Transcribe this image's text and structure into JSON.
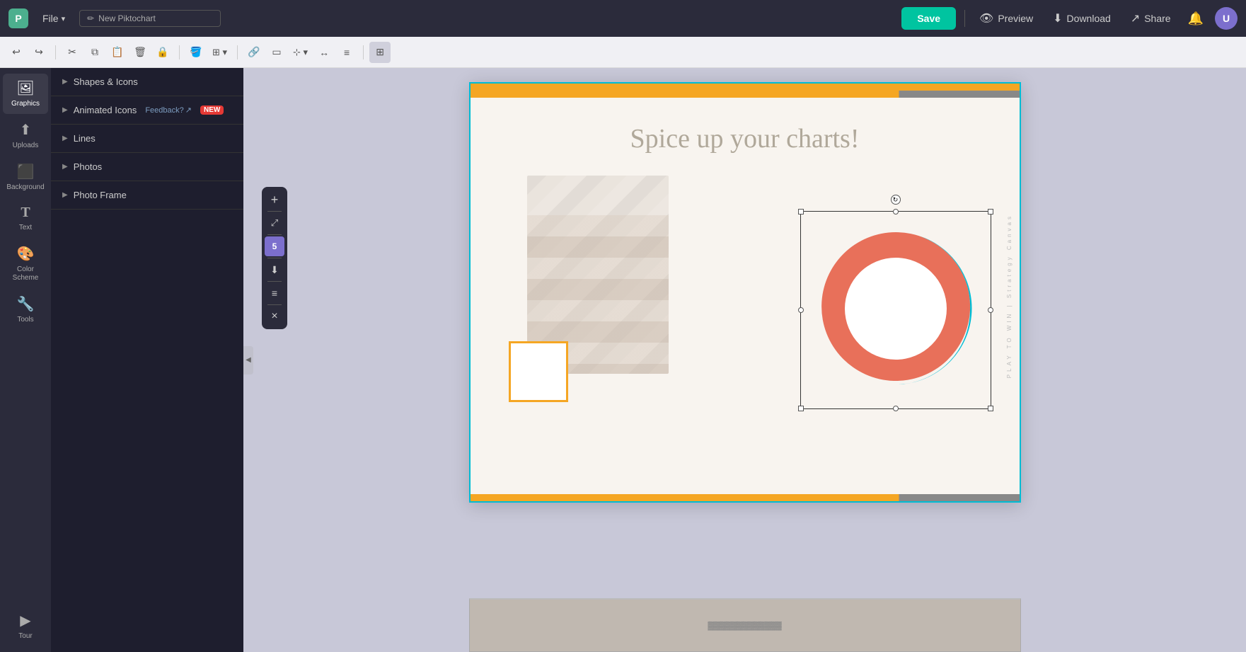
{
  "topbar": {
    "logo": "P",
    "file_label": "File",
    "file_arrow": "▾",
    "title_icon": "✏",
    "title_value": "New Piktochart",
    "save_label": "Save",
    "preview_label": "Preview",
    "download_label": "Download",
    "share_label": "Share",
    "avatar_letter": "U"
  },
  "toolbar2": {
    "buttons": [
      {
        "id": "undo",
        "icon": "↩",
        "title": "Undo"
      },
      {
        "id": "redo",
        "icon": "↪",
        "title": "Redo"
      },
      {
        "id": "cut",
        "icon": "✂",
        "title": "Cut"
      },
      {
        "id": "copy",
        "icon": "⧉",
        "title": "Copy"
      },
      {
        "id": "paste",
        "icon": "📋",
        "title": "Paste"
      },
      {
        "id": "delete",
        "icon": "🗑",
        "title": "Delete"
      },
      {
        "id": "lock",
        "icon": "🔒",
        "title": "Lock"
      },
      {
        "id": "fill",
        "icon": "🪣",
        "title": "Fill"
      },
      {
        "id": "grid",
        "icon": "⊞",
        "title": "Grid"
      },
      {
        "id": "link",
        "icon": "🔗",
        "title": "Link"
      },
      {
        "id": "bg",
        "icon": "▭",
        "title": "Background"
      },
      {
        "id": "arrange",
        "icon": "⊹",
        "title": "Arrange"
      },
      {
        "id": "flip",
        "icon": "↔",
        "title": "Flip"
      },
      {
        "id": "align",
        "icon": "≡",
        "title": "Align"
      },
      {
        "id": "more",
        "icon": "⊞",
        "title": "More",
        "active": true
      }
    ]
  },
  "sidebar": {
    "items": [
      {
        "id": "graphics",
        "icon": "🖼",
        "label": "Graphics",
        "active": true
      },
      {
        "id": "uploads",
        "icon": "⬆",
        "label": "Uploads"
      },
      {
        "id": "background",
        "icon": "⬛",
        "label": "Background"
      },
      {
        "id": "text",
        "icon": "T",
        "label": "Text"
      },
      {
        "id": "colorscheme",
        "icon": "🎨",
        "label": "Color Scheme"
      },
      {
        "id": "tools",
        "icon": "🔧",
        "label": "Tools"
      }
    ],
    "bottom_items": [
      {
        "id": "tour",
        "icon": "▶",
        "label": "Tour"
      }
    ]
  },
  "panel": {
    "sections": [
      {
        "id": "shapes-icons",
        "label": "Shapes & Icons",
        "expanded": false,
        "arrow": "▶"
      },
      {
        "id": "animated-icons",
        "label": "Animated Icons",
        "expanded": false,
        "arrow": "▶",
        "badge": "NEW",
        "feedback_label": "Feedback?",
        "feedback_icon": "↗"
      },
      {
        "id": "lines",
        "label": "Lines",
        "expanded": false,
        "arrow": "▶"
      },
      {
        "id": "photos",
        "label": "Photos",
        "expanded": false,
        "arrow": "▶"
      },
      {
        "id": "photo-frame",
        "label": "Photo Frame",
        "expanded": false,
        "arrow": "▶"
      }
    ]
  },
  "canvas": {
    "heading": "Spice up your charts!",
    "vertical_text": "PLAY TO WIN | Strategy Canvas",
    "donut": {
      "color_salmon": "#e8705a",
      "color_teal": "#00bcd4",
      "inner_bg": "#fff"
    },
    "orange_bar_color": "#f5a623",
    "teal_border_color": "#00bcd4"
  },
  "float_toolbar": {
    "buttons": [
      {
        "id": "plus",
        "icon": "+",
        "title": "Add"
      },
      {
        "id": "resize",
        "icon": "⤢",
        "title": "Resize"
      },
      {
        "id": "page-count",
        "label": "5"
      },
      {
        "id": "duplicate",
        "icon": "⬇",
        "title": "Duplicate"
      },
      {
        "id": "layer",
        "icon": "≡",
        "title": "Layers"
      },
      {
        "id": "close",
        "icon": "×",
        "title": "Close"
      }
    ]
  }
}
